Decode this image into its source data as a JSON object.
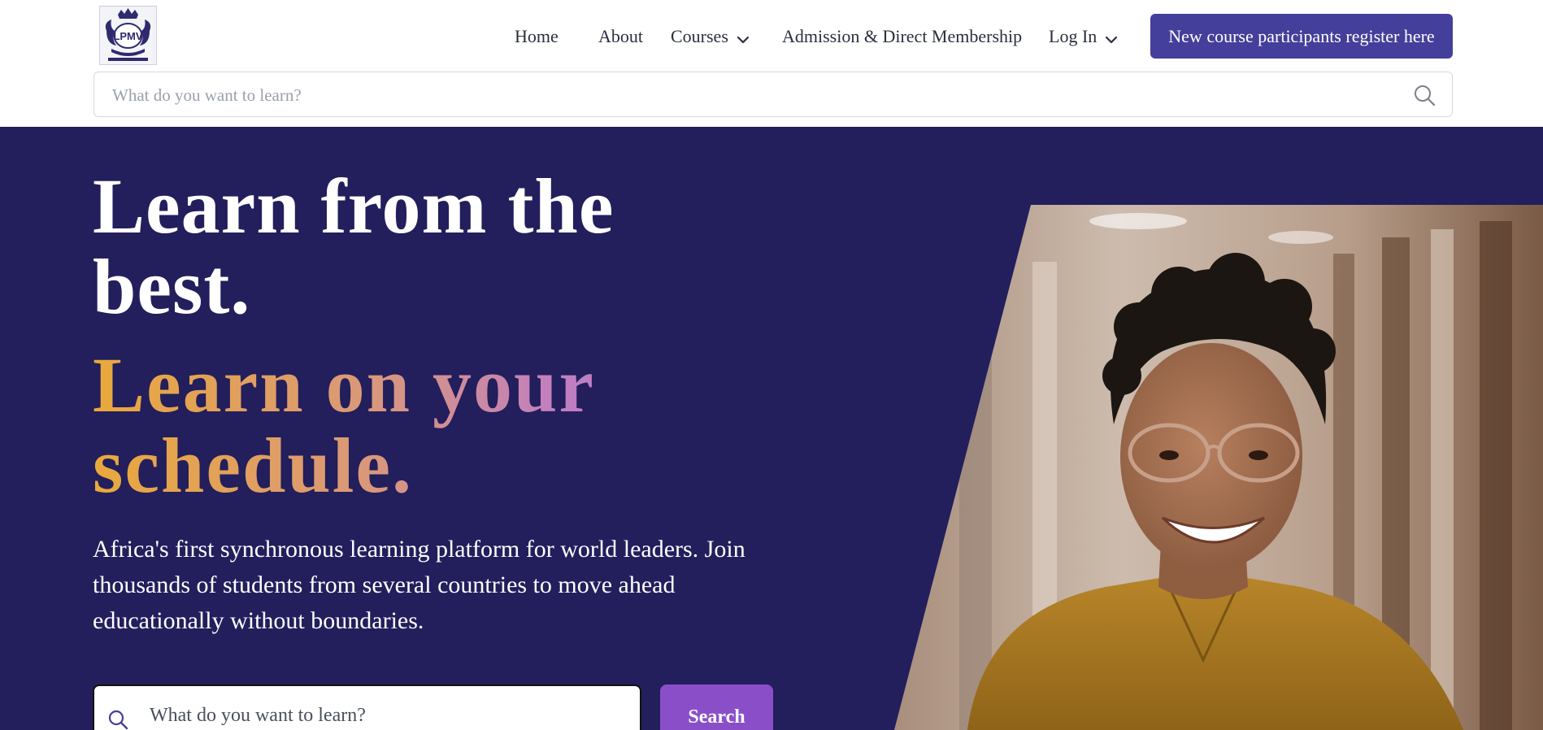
{
  "header": {
    "logo_text": "LPMV",
    "nav": {
      "home": "Home",
      "about": "About",
      "courses": "Courses",
      "admission": "Admission & Direct Membership",
      "login": "Log In"
    },
    "register_button": "New course participants register here",
    "search": {
      "placeholder": "What do you want to learn?"
    }
  },
  "hero": {
    "headline_line1": "Learn from the best.",
    "headline_line2": "Learn on your schedule.",
    "lead": "Africa's first synchronous learning platform for world leaders. Join thousands of students from several countries to move ahead educationally without boundaries.",
    "search": {
      "placeholder": "What do you want to learn?"
    },
    "search_button": "Search"
  },
  "colors": {
    "accent": "#443f9a",
    "hero_bg": "#231e5c",
    "search_button": "#8a4fc8",
    "gradient_start": "#e9a93c",
    "gradient_end": "#b87ad0"
  },
  "icons": {
    "chevron": "chevron-down-icon",
    "search": "search-icon"
  }
}
